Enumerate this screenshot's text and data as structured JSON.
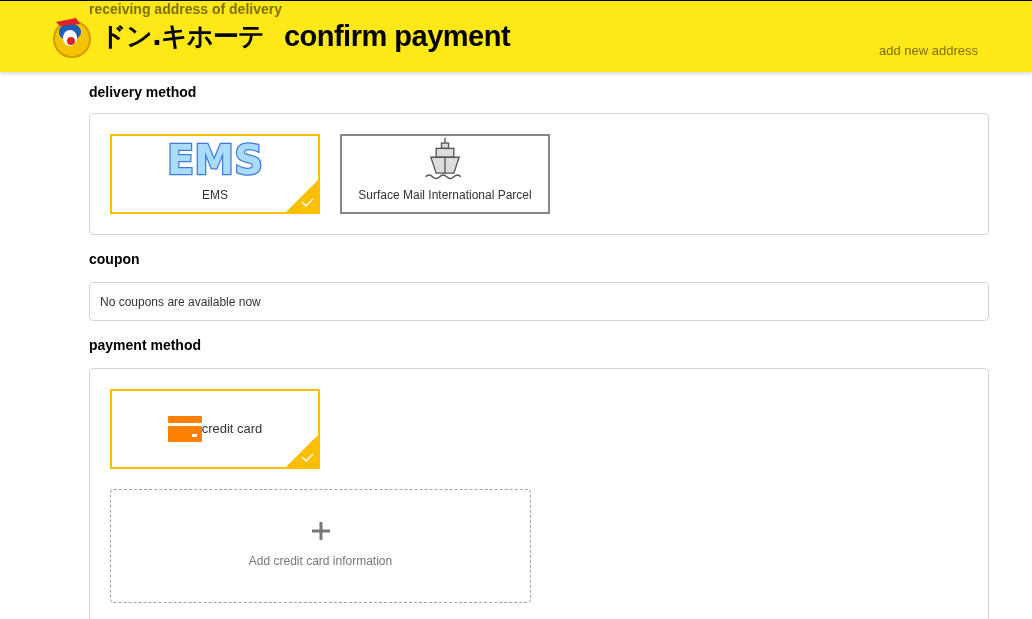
{
  "header": {
    "logo_text": "ドン.キホーテ",
    "title": "confirm payment"
  },
  "address": {
    "label": "receiving address of delivery",
    "action": "add new address"
  },
  "delivery": {
    "label": "delivery method",
    "options": [
      {
        "kind": "ems",
        "logo_text": "EMS",
        "label": "EMS",
        "selected": true
      },
      {
        "kind": "ship",
        "label": "Surface Mail International Parcel",
        "selected": false
      }
    ]
  },
  "coupon": {
    "label": "coupon",
    "message": "No coupons are available now"
  },
  "payment": {
    "label": "payment method",
    "options": [
      {
        "kind": "card",
        "label": "credit card",
        "selected": true
      }
    ],
    "add_card": {
      "label": "Add credit card information"
    }
  }
}
